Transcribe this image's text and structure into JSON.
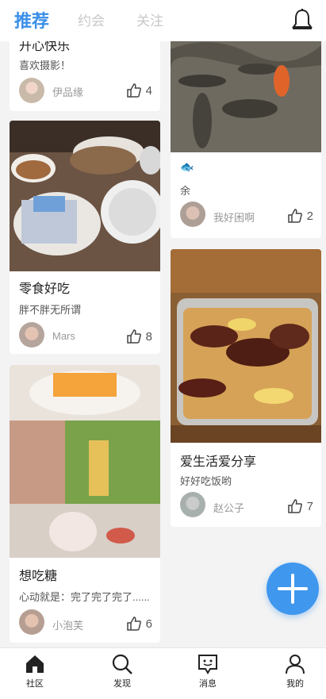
{
  "header": {
    "tabs": [
      {
        "label": "推荐",
        "active": true
      },
      {
        "label": "约会",
        "active": false
      },
      {
        "label": "关注",
        "active": false
      }
    ],
    "bell_icon": "bell-icon"
  },
  "feed": {
    "left": [
      {
        "title": "开心快乐",
        "desc": "喜欢摄影！",
        "author": "伊品缘",
        "likes": "4"
      },
      {
        "title": "零食好吃",
        "desc": "胖不胖无所谓",
        "author": "Mars",
        "likes": "8"
      },
      {
        "title": "想吃糖",
        "desc": "心动就是：完了完了完了......",
        "author": "小泡芙",
        "likes": "6"
      }
    ],
    "right": [
      {
        "title": "🐟",
        "desc": "余",
        "author": "我好困啊",
        "likes": "2"
      },
      {
        "title": "爱生活爱分享",
        "desc": "好好吃饭哟",
        "author": "赵公子",
        "likes": "7"
      }
    ]
  },
  "fab": {
    "icon": "plus-icon"
  },
  "bottom_nav": [
    {
      "label": "社区",
      "icon": "home-icon"
    },
    {
      "label": "发现",
      "icon": "search-icon"
    },
    {
      "label": "消息",
      "icon": "message-icon"
    },
    {
      "label": "我的",
      "icon": "profile-icon"
    }
  ],
  "colors": {
    "accent": "#3a8fe8",
    "fab": "#3f97ee"
  }
}
